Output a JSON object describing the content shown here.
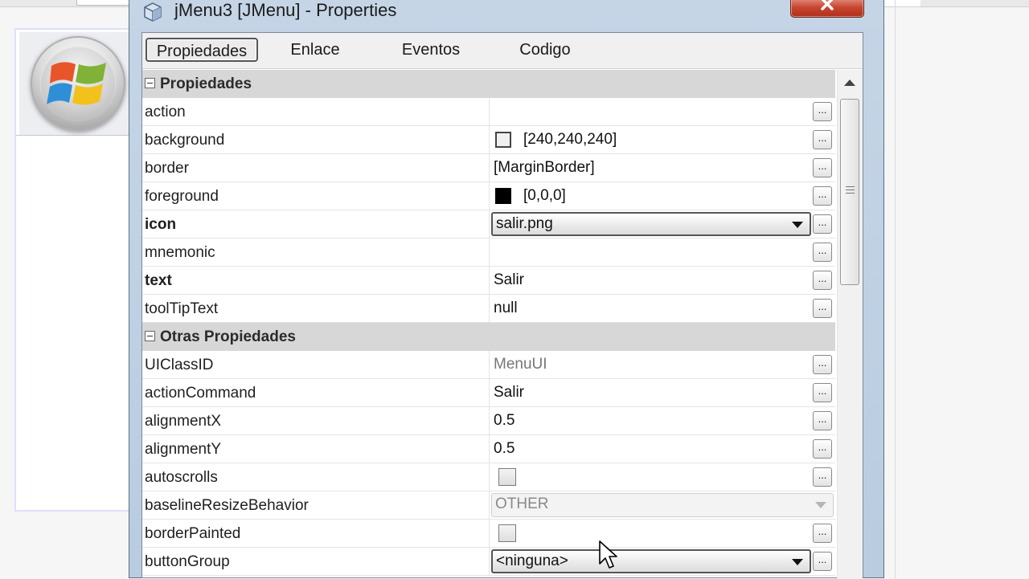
{
  "window": {
    "title": "jMenu3 [JMenu] - Properties"
  },
  "tabs": [
    {
      "label": "Propiedades",
      "active": true
    },
    {
      "label": "Enlace",
      "active": false
    },
    {
      "label": "Eventos",
      "active": false
    },
    {
      "label": "Codigo",
      "active": false
    }
  ],
  "categories": {
    "propiedades": "Propiedades",
    "otras": "Otras Propiedades"
  },
  "properties": [
    {
      "name": "action",
      "value": "",
      "bold": false
    },
    {
      "name": "background",
      "value": "[240,240,240]",
      "color": "#f0f0f0"
    },
    {
      "name": "border",
      "value": "[MarginBorder]"
    },
    {
      "name": "foreground",
      "value": "[0,0,0]",
      "color": "#000000"
    },
    {
      "name": "icon",
      "value": "salir.png",
      "bold": true
    },
    {
      "name": "mnemonic",
      "value": ""
    },
    {
      "name": "text",
      "value": "Salir",
      "bold": true
    },
    {
      "name": "toolTipText",
      "value": "null"
    }
  ],
  "other_properties": [
    {
      "name": "UIClassID",
      "value": "MenuUI"
    },
    {
      "name": "actionCommand",
      "value": "Salir"
    },
    {
      "name": "alignmentX",
      "value": "0.5"
    },
    {
      "name": "alignmentY",
      "value": "0.5"
    },
    {
      "name": "autoscrolls",
      "value": "",
      "checked": false
    },
    {
      "name": "baselineResizeBehavior",
      "value": "OTHER"
    },
    {
      "name": "borderPainted",
      "value": "",
      "checked": false
    },
    {
      "name": "buttonGroup",
      "value": "<ninguna>"
    }
  ],
  "ellipsis_label": "...",
  "colors": {
    "dialog_frame": "#c5d5e6",
    "category_bg": "#d7d7d7",
    "close_button": "#c8452f"
  }
}
